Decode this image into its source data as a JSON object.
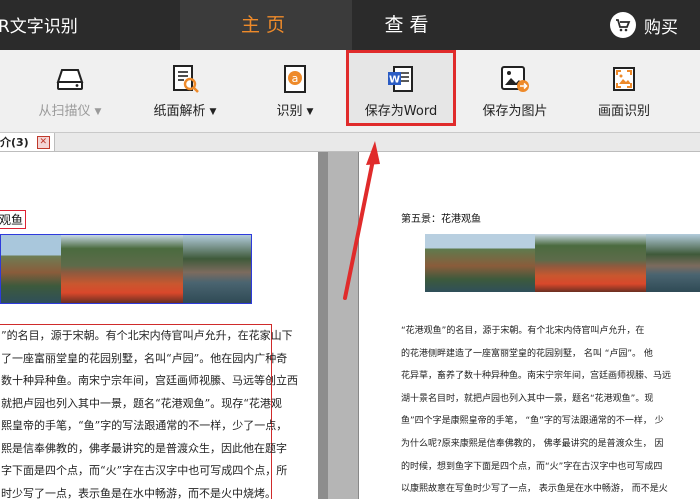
{
  "titlebar": {
    "app_title": "R文字识别",
    "tab_home": "主页",
    "tab_view": "查看",
    "buy_label": "购买",
    "icons": {
      "buy": "cart-icon"
    }
  },
  "toolbar": {
    "items": [
      {
        "label": "从扫描仪",
        "icon": "scanner-icon",
        "has_dropdown": true,
        "disabled": true
      },
      {
        "label": "纸面解析",
        "icon": "page-analysis-icon",
        "has_dropdown": true,
        "disabled": false
      },
      {
        "label": "识别",
        "icon": "recognize-icon",
        "has_dropdown": true,
        "disabled": false
      },
      {
        "label": "保存为Word",
        "icon": "word-icon",
        "has_dropdown": false,
        "disabled": false,
        "highlighted": true
      },
      {
        "label": "保存为图片",
        "icon": "save-image-icon",
        "has_dropdown": false,
        "disabled": false
      },
      {
        "label": "画面识别",
        "icon": "screen-capture-icon",
        "has_dropdown": false,
        "disabled": false
      }
    ],
    "caret": "▼"
  },
  "doc_tab": {
    "label": "介(3)",
    "close": "✕"
  },
  "left_doc": {
    "heading": "观鱼",
    "lines": [
      "”的名目，源于宋朝。有个北宋内侍官叫卢允升，在花家山下",
      "了一座富丽堂皇的花园别墅，名叫“卢园”。他在园内广种奇",
      "数十种异种鱼。南宋宁宗年间，宫廷画师视縢、马远等创立西",
      "就把卢园也列入其中一景，题名“花港观鱼”。现存“花港观",
      "熙皇帝的手笔，“鱼”字的写法跟通常的不一样，少了一点，",
      "熙是信奉佛教的，佛孝最讲究的是普渡众生，因此他在题字",
      "字下面是四个点，而“火”字在古汉字中也可写成四个点，所",
      "时少写了一点，表示鱼是在水中畅游，而不是火中烧烤。"
    ]
  },
  "right_doc": {
    "heading": "第五景：花港观鱼",
    "lines": [
      "“花港观鱼”的名目，源于宋朝。有个北宋内侍官叫卢允升，在",
      "的花港侧畔建造了一座富丽堂皇的花园别墅， 名叫 “卢园”。 他",
      "花异草，畜养了数十种异种鱼。南宋宁宗年间，宫廷画师视縢、马远",
      "湖十景名目时，就把卢园也列入其中一景，题名“花港观鱼”。现",
      "鱼”四个字是康熙皇帝的手笔，  “鱼”字的写法跟通常的不一样，  少",
      "为什么呢?原来康熙是信奉佛教的，  佛孝最讲究的是普渡众生，  因",
      "的时候，想到鱼字下面是四个点，而“火”字在古汉字中也可写成四",
      "以康熙故意在写鱼时少写了一点，  表示鱼是在水中畅游，  而不是火"
    ]
  },
  "colors": {
    "titlebar_bg": "#2b2b2b",
    "accent_orange": "#ee8a2a",
    "highlight_red": "#e02b2b",
    "toolbar_bg": "#f0f0f0",
    "photo_box_blue": "#2e3bdc"
  }
}
